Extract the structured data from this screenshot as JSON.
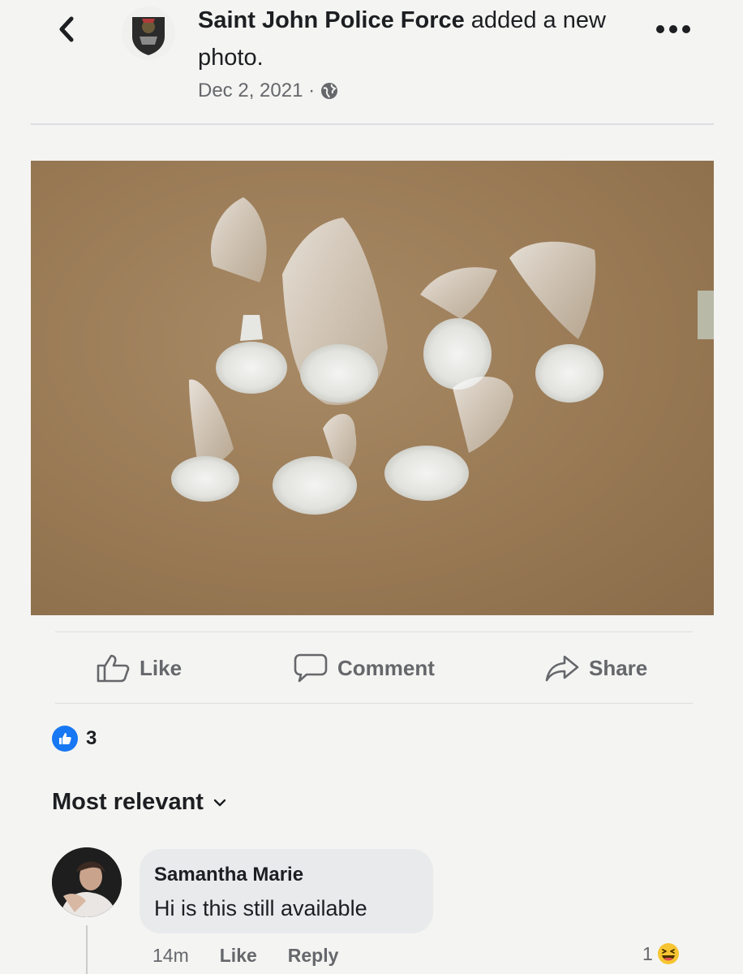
{
  "post": {
    "page_name": "Saint John Police Force",
    "action_text": " added a new photo.",
    "date": "Dec 2, 2021 ·",
    "privacy_icon": "globe-icon"
  },
  "actions": {
    "like": "Like",
    "comment": "Comment",
    "share": "Share"
  },
  "reactions": {
    "count": "3",
    "type": "like"
  },
  "comments_section": {
    "sort_label": "Most relevant"
  },
  "comment": {
    "author": "Samantha Marie",
    "text": "Hi is this still available",
    "time": "14m",
    "like": "Like",
    "reply": "Reply",
    "reaction_count": "1",
    "reaction_type": "haha"
  },
  "colors": {
    "accent": "#1877f2",
    "secondary_text": "#65676b",
    "bubble": "#e9eaec"
  }
}
